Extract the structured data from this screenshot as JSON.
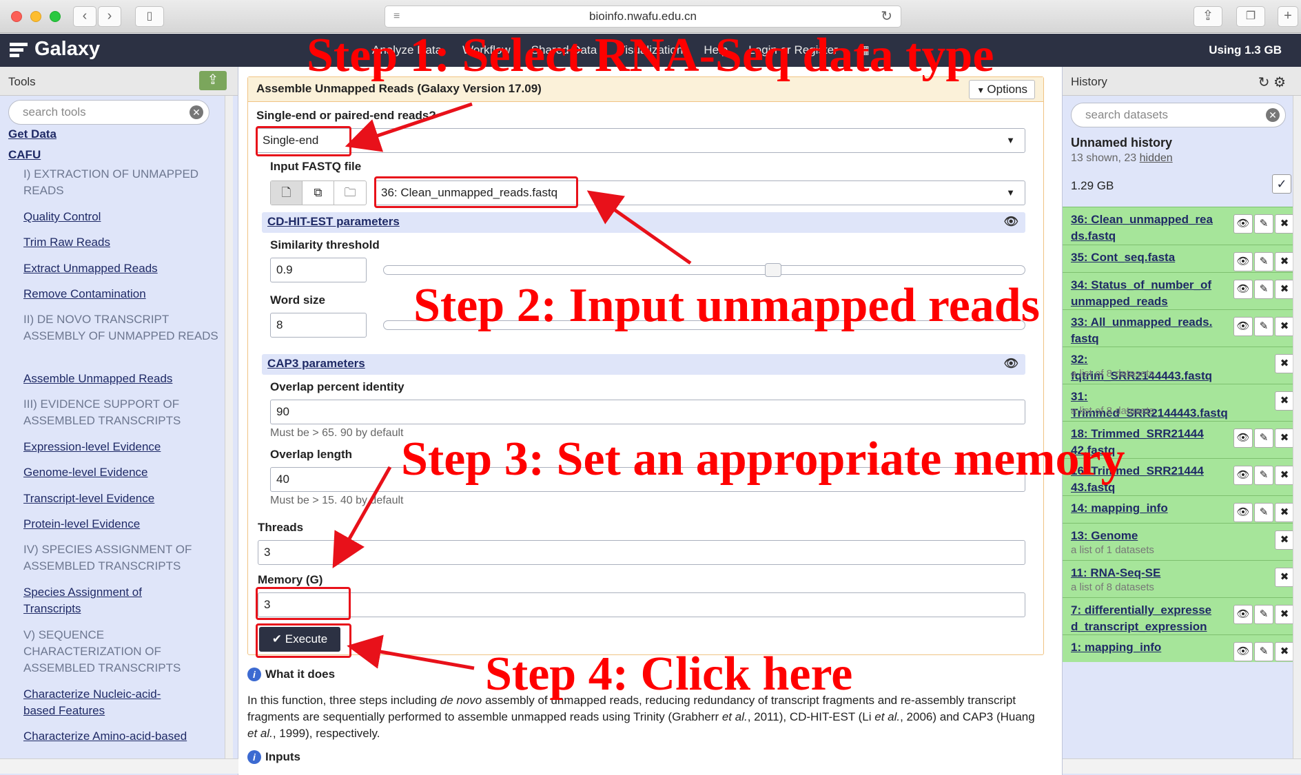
{
  "browser": {
    "url": "bioinfo.nwafu.edu.cn"
  },
  "masthead": {
    "brand": "Galaxy",
    "nav": [
      "Analyze Data",
      "Workflow",
      "Shared Data",
      "Visualization",
      "Help",
      "Login or Register"
    ],
    "quota": "Using 1.3 GB"
  },
  "tools": {
    "title": "Tools",
    "search_placeholder": "search tools",
    "categories": [
      "Get Data",
      "CAFU"
    ],
    "items": [
      "I) EXTRACTION OF UNMAPPED READS",
      "Quality Control",
      "Trim Raw Reads",
      "Extract Unmapped Reads",
      "Remove Contamination",
      "II) DE NOVO TRANSCRIPT ASSEMBLY OF UNMAPPED READS",
      "Assemble Unmapped Reads",
      "III) EVIDENCE SUPPORT OF ASSEMBLED TRANSCRIPTS",
      "Expression-level Evidence",
      "Genome-level Evidence",
      "Transcript-level Evidence",
      "Protein-level Evidence",
      "IV) SPECIES ASSIGNMENT OF ASSEMBLED TRANSCRIPTS",
      "Species Assignment of Transcripts",
      "V) SEQUENCE CHARACTERIZATION OF ASSEMBLED TRANSCRIPTS",
      "Characterize Nucleic-acid-based Features",
      "Characterize Amino-acid-based Features"
    ]
  },
  "form": {
    "title": "Assemble Unmapped Reads (Galaxy Version 17.09)",
    "options": "Options",
    "read_type_label": "Single-end or paired-end reads?",
    "read_type_value": "Single-end",
    "fastq_label": "Input FASTQ file",
    "fastq_value": "36: Clean_unmapped_reads.fastq",
    "cdhit_section": "CD-HIT-EST parameters",
    "similarity_label": "Similarity threshold",
    "similarity_value": "0.9",
    "similarity_slider": 0.9,
    "word_label": "Word size",
    "word_value": "8",
    "cap3_section": "CAP3 parameters",
    "overlap_identity_label": "Overlap percent identity",
    "overlap_identity_value": "90",
    "overlap_identity_help": "Must be > 65. 90 by default",
    "overlap_length_label": "Overlap length",
    "overlap_length_value": "40",
    "overlap_length_help": "Must be > 15. 40 by default",
    "threads_label": "Threads",
    "threads_value": "3",
    "memory_label": "Memory (G)",
    "memory_value": "3",
    "execute": "Execute"
  },
  "help": {
    "what_it_does": "What it does",
    "text_before": "In this function, three steps including ",
    "text_italic_1": "de novo",
    "text_middle_1": " assembly of unmapped reads, reducing redundancy of transcript fragments and re-assembly transcript fragments are sequentially performed to assemble unmapped reads using Trinity (Grabherr ",
    "text_italic_2": "et al.",
    "text_middle_2": ", 2011), CD-HIT-EST (Li ",
    "text_italic_3": "et al.",
    "text_middle_3": ", 2006) and CAP3 (Huang ",
    "text_italic_4": "et al.",
    "text_end": ", 1999), respectively.",
    "inputs": "Inputs"
  },
  "history": {
    "title": "History",
    "search_placeholder": "search datasets",
    "name": "Unnamed history",
    "shown": "13 shown, 23 ",
    "hidden": "hidden",
    "size": "1.29 GB",
    "datasets": [
      {
        "name": "36: Clean_unmapped_rea ds.fastq",
        "sub": ""
      },
      {
        "name": "35: Cont_seq.fasta",
        "sub": ""
      },
      {
        "name": "34: Status_of_number_of unmapped_reads",
        "sub": ""
      },
      {
        "name": "33: All_unmapped_reads. fastq",
        "sub": ""
      },
      {
        "name": "32: fqtrim_SRR2144443.fastq",
        "sub": "a list of 8 datasets"
      },
      {
        "name": "31: Trimmed_SRR2144443.fastq",
        "sub": "a list of 8 datasets"
      },
      {
        "name": "18: Trimmed_SRR21444 42.fastq",
        "sub": ""
      },
      {
        "name": "16: Trimmed_SRR21444 43.fastq",
        "sub": ""
      },
      {
        "name": "14: mapping_info",
        "sub": ""
      },
      {
        "name": "13: Genome",
        "sub": "a list of 1 datasets"
      },
      {
        "name": "11: RNA-Seq-SE",
        "sub": "a list of 8 datasets"
      },
      {
        "name": "7: differentially_expresse d_transcript_expression",
        "sub": ""
      },
      {
        "name": "1: mapping_info",
        "sub": ""
      }
    ]
  },
  "annotations": {
    "step1": "Step 1: Select RNA-Seq data type",
    "step2": "Step 2: Input unmapped reads",
    "step3": "Step 3: Set an appropriate memory",
    "step4": "Step 4: Click here",
    "color": "#ff0000"
  },
  "icons": [
    "upload-icon",
    "search-clear-icon",
    "caret-down-icon",
    "file-icon",
    "files-icon",
    "folder-icon",
    "eye-icon",
    "check-icon",
    "info-icon",
    "refresh-icon",
    "gear-icon",
    "pencil-icon",
    "delete-icon"
  ]
}
